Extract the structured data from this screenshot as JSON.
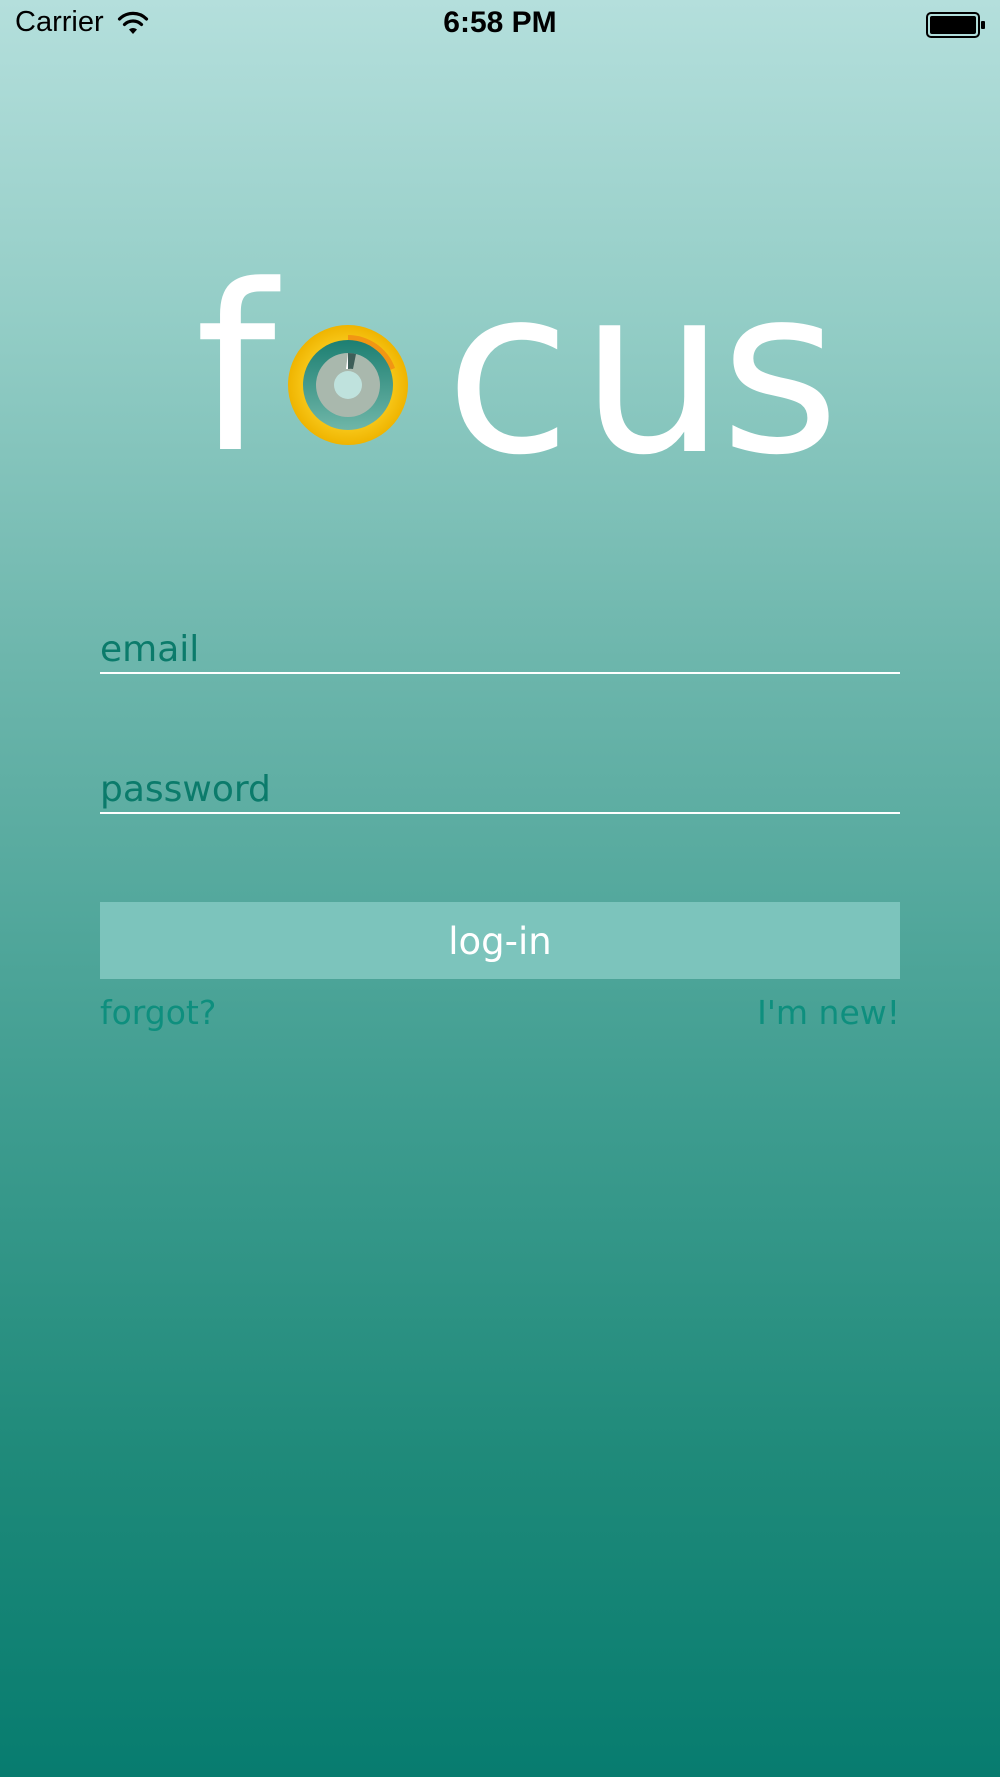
{
  "status_bar": {
    "carrier": "Carrier",
    "time": "6:58 PM",
    "wifi_icon": "wifi-icon",
    "battery_icon": "battery-full-icon"
  },
  "logo": {
    "text": "focus",
    "letters": {
      "f": "f",
      "c": "c",
      "u": "u",
      "s": "s"
    },
    "o_icon": "focus-ring-o-icon"
  },
  "form": {
    "email": {
      "value": "",
      "placeholder": "email"
    },
    "password": {
      "value": "",
      "placeholder": "password"
    },
    "login_label": "log-in",
    "forgot_label": "forgot?",
    "new_label": "I'm new!"
  },
  "colors": {
    "gradient_top": "#b4dfdc",
    "gradient_bottom": "#077c6f",
    "field_text": "#0b7b6b",
    "link_text": "#0e8f7e",
    "button_bg": "#7cc4bc",
    "logo_yellow": "#f6c012",
    "logo_orange": "#f29613"
  }
}
